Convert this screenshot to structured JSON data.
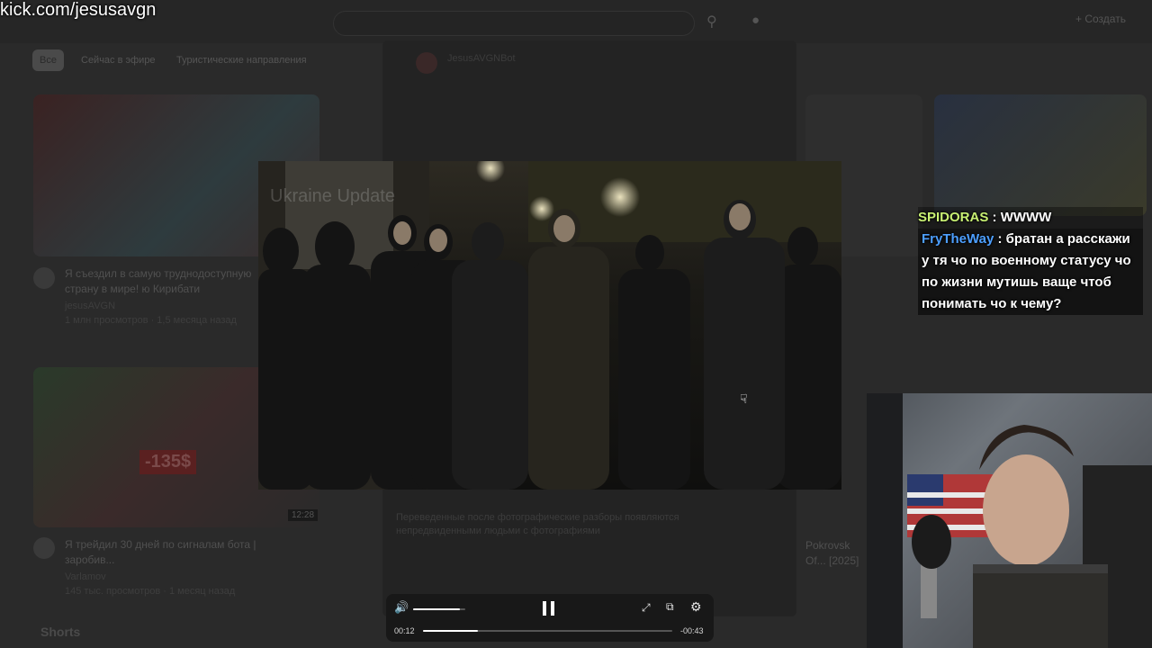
{
  "overlay_url": "kick.com/jesusavgn",
  "background_page": {
    "chips": [
      "Все",
      "Сейчас в эфире",
      "Туристические направления"
    ],
    "create_label": "Создать",
    "cards": [
      {
        "title": "Я съездил в самую труднодоступную страну в мире! ю Кирибати",
        "channel": "jesusAVGN",
        "meta": "1 млн просмотров · 1,5 месяца назад"
      },
      {
        "title": "Я трейдил 30 дней по сигналам бота | заробив...",
        "channel": "Varlamov",
        "meta": "145 тыс. просмотров · 1 месяц назад",
        "badge": "-135$",
        "duration": "12:28"
      }
    ],
    "right_card_title": "Pokrovsk Of... [2025]",
    "shorts_label": "Shorts",
    "modal": {
      "channel": "JesusAVGNBot",
      "desc": "Переведенные после фотографические разборы появляются непредвиденными людьми с фотографиями"
    }
  },
  "video": {
    "watermark": "Ukraine Update"
  },
  "chat": {
    "messages": [
      {
        "user": "SPIDORAS",
        "text": "WWWW"
      },
      {
        "user": "FryTheWay",
        "text": "братан а расскажи у тя чо по военному статусу чо по жизни мутишь ваще чтоб понимать чо к чему?"
      }
    ]
  },
  "player": {
    "current_time": "00:12",
    "remaining_time": "-00:43",
    "progress": 0.22,
    "volume": 0.9,
    "state": "playing"
  }
}
